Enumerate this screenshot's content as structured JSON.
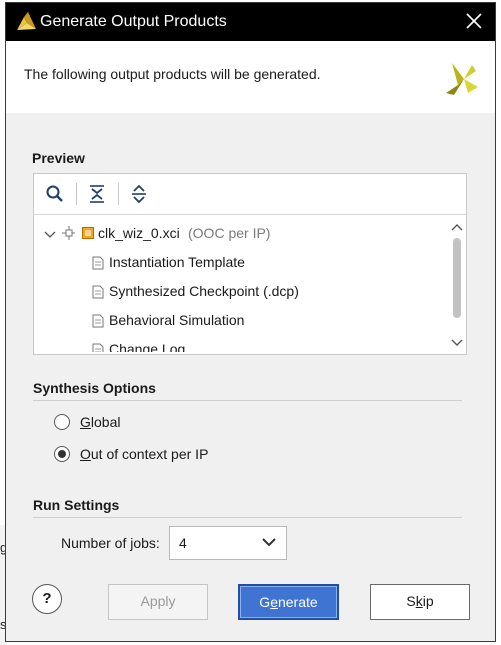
{
  "background": {
    "chars": [
      "g",
      "s"
    ]
  },
  "dialog": {
    "title": "Generate Output Products",
    "description": "The following output products will be generated."
  },
  "preview": {
    "label": "Preview",
    "tree": {
      "root": {
        "name": "clk_wiz_0.xci",
        "suffix": "(OOC per IP)"
      },
      "children": [
        "Instantiation Template",
        "Synthesized Checkpoint (.dcp)",
        "Behavioral Simulation",
        "Change Log"
      ]
    }
  },
  "synthesis": {
    "label": "Synthesis Options",
    "options": [
      {
        "underline": "G",
        "rest": "lobal",
        "selected": false
      },
      {
        "underline": "O",
        "rest": "ut of context per IP",
        "selected": true
      }
    ]
  },
  "run_settings": {
    "label": "Run Settings",
    "jobs_label": "Number of jobs:",
    "jobs_value": "4"
  },
  "buttons": {
    "help": "?",
    "apply": "Apply",
    "generate_pre": "G",
    "generate_u": "e",
    "generate_post": "nerate",
    "skip_pre": "S",
    "skip_u": "k",
    "skip_post": "ip"
  },
  "colors": {
    "accent": "#3f74d3",
    "titlebar": "#000000",
    "logo": "#c4c21a"
  }
}
